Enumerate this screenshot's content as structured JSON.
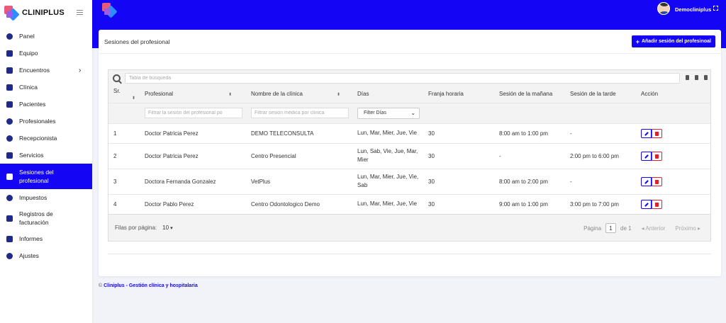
{
  "sidebar": {
    "brand": "CLINIPLUS",
    "items": [
      {
        "label": "Panel",
        "icon": "dashboard-icon"
      },
      {
        "label": "Equipo",
        "icon": "briefcase-icon"
      },
      {
        "label": "Encuentros",
        "icon": "calendar-icon"
      },
      {
        "label": "Clínica",
        "icon": "hospital-icon"
      },
      {
        "label": "Pacientes",
        "icon": "patients-icon"
      },
      {
        "label": "Profesionales",
        "icon": "user-icon"
      },
      {
        "label": "Recepcionista",
        "icon": "users-icon"
      },
      {
        "label": "Servicios",
        "icon": "list-icon"
      },
      {
        "label": "Sesiones del profesional",
        "icon": "clipboard-icon"
      },
      {
        "label": "Impuestos",
        "icon": "tax-icon"
      },
      {
        "label": "Registros de facturación",
        "icon": "invoice-icon"
      },
      {
        "label": "Informes",
        "icon": "chart-icon"
      },
      {
        "label": "Ajustes",
        "icon": "gear-icon"
      }
    ]
  },
  "header": {
    "username": "Democliniplus"
  },
  "card": {
    "title": "Sesiones del profesional",
    "add_button": "Añadir sesión del profesinoal"
  },
  "table": {
    "search_placeholder": "Tabla de búsqueda",
    "columns": [
      "Sr.",
      "Profesional",
      "Nombre de la clínica",
      "Días",
      "Franja horaria",
      "Sesión de la mañana",
      "Sesión de la tarde",
      "Acción"
    ],
    "filters": {
      "professional_placeholder": "Filtrar la sesión del profesional po",
      "clinic_placeholder": "Filtrar sesión médica por clínica",
      "days_select": "Filter Días"
    },
    "rows": [
      {
        "sr": "1",
        "professional": "Doctor Patricia Perez",
        "clinic": "DEMO TELECONSULTA",
        "days": "Lun, Mar, Mier, Jue, Vie",
        "slot": "30",
        "morning": "8:00 am to 1:00 pm",
        "evening": "-"
      },
      {
        "sr": "2",
        "professional": "Doctor Patricia Perez",
        "clinic": "Centro Presencial",
        "days": "Lun, Sab, Vie, Jue, Mar, Mier",
        "slot": "30",
        "morning": "-",
        "evening": "2:00 pm to 6:00 pm"
      },
      {
        "sr": "3",
        "professional": "Doctora Fernanda Gonzalez",
        "clinic": "VetPlus",
        "days": "Lun, Mar, Mier, Jue, Vie, Sab",
        "slot": "30",
        "morning": "8:00 am to 2:00 pm",
        "evening": "-"
      },
      {
        "sr": "4",
        "professional": "Doctor Pablo Perez",
        "clinic": "Centro Odontologico Demo",
        "days": "Lun, Mar, Mier, Jue, Vie",
        "slot": "30",
        "morning": "9:00 am to 1:00 pm",
        "evening": "3:00 pm to 7:00 pm"
      }
    ]
  },
  "pager": {
    "rows_per_page_label": "Filas por página:",
    "rows_per_page_value": "10",
    "page_label": "Página",
    "page_value": "1",
    "of_label": "de 1",
    "prev": "◂ Anterior",
    "next": "Próximo ▸"
  },
  "footer": {
    "copyright": "©",
    "brand": "Cliniplus - Gestión clínica y hospitalaria"
  },
  "colors": {
    "primary": "#1405f5",
    "danger": "#e0202a"
  }
}
